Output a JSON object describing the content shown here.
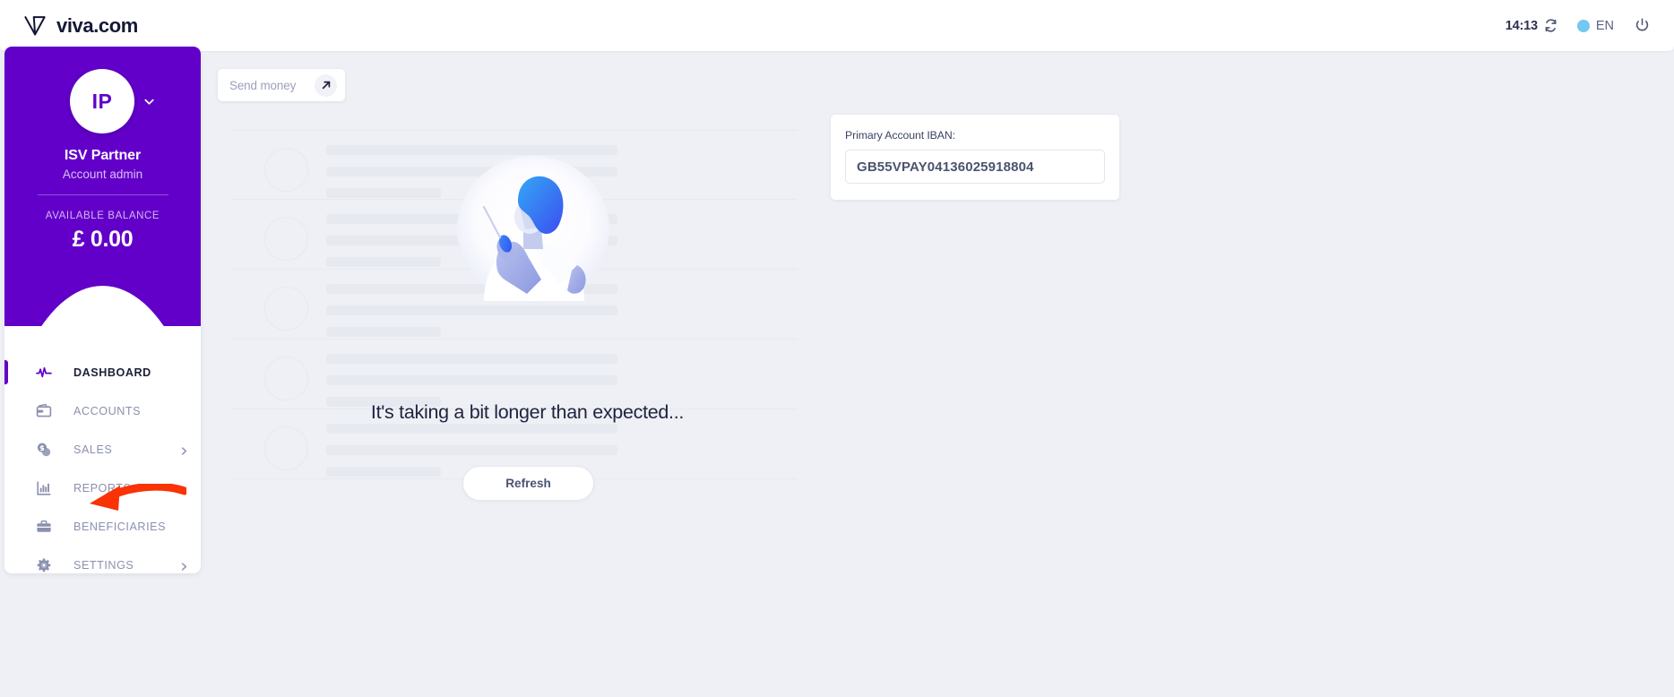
{
  "header": {
    "brand_name": "viva.com",
    "logo_icon": "viva-w-logo-icon",
    "clock_time": "14:13",
    "refresh_icon": "refresh-icon",
    "globe_icon": "globe-icon",
    "language": "EN",
    "power_icon": "power-icon"
  },
  "sidebar": {
    "avatar_initials": "IP",
    "avatar_chevron_icon": "chevron-down-icon",
    "account_name": "ISV Partner",
    "account_role": "Account admin",
    "balance_label": "AVAILABLE BALANCE",
    "balance_amount": "£ 0.00",
    "accent_color": "#6200c9",
    "items": [
      {
        "label": "DASHBOARD",
        "icon": "activity-pulse-icon",
        "active": true,
        "has_chevron": false
      },
      {
        "label": "ACCOUNTS",
        "icon": "wallet-icon",
        "active": false,
        "has_chevron": false
      },
      {
        "label": "SALES",
        "icon": "sales-chat-icon",
        "active": false,
        "has_chevron": true
      },
      {
        "label": "REPORTS",
        "icon": "bar-chart-icon",
        "active": false,
        "has_chevron": true
      },
      {
        "label": "BENEFICIARIES",
        "icon": "briefcase-icon",
        "active": false,
        "has_chevron": false
      },
      {
        "label": "SETTINGS",
        "icon": "gear-icon",
        "active": false,
        "has_chevron": true
      }
    ]
  },
  "send_money": {
    "label": "Send money",
    "action_icon": "arrow-up-right-icon"
  },
  "iban_card": {
    "label": "Primary Account IBAN:",
    "value": "GB55VPAY04136025918804"
  },
  "main": {
    "loading_message": "It's taking a bit longer than expected...",
    "refresh_button": "Refresh",
    "illustration_icon": "person-writing-illustration",
    "skeleton_rows": 5
  },
  "annotation": {
    "arrow_icon": "red-arrow-pointing-left-icon",
    "arrow_color": "#f93305",
    "points_at": "SALES"
  }
}
